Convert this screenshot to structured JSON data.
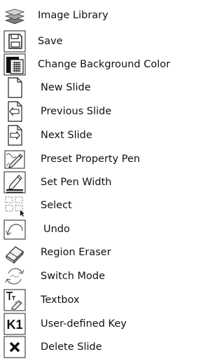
{
  "items": [
    {
      "label": "Image Library",
      "icon": "image-library-icon"
    },
    {
      "label": "Save",
      "icon": "save-icon"
    },
    {
      "label": "Change Background Color",
      "icon": "background-color-icon"
    },
    {
      "label": "New Slide",
      "icon": "new-slide-icon"
    },
    {
      "label": "Previous Slide",
      "icon": "previous-slide-icon"
    },
    {
      "label": "Next Slide",
      "icon": "next-slide-icon"
    },
    {
      "label": "Preset Property Pen",
      "icon": "preset-pen-icon"
    },
    {
      "label": "Set Pen Width",
      "icon": "pen-width-icon"
    },
    {
      "label": "Select",
      "icon": "select-icon"
    },
    {
      "label": "Undo",
      "icon": "undo-icon"
    },
    {
      "label": "Region Eraser",
      "icon": "eraser-icon"
    },
    {
      "label": "Switch Mode",
      "icon": "switch-mode-icon"
    },
    {
      "label": "Textbox",
      "icon": "textbox-icon"
    },
    {
      "label": "User-defined Key",
      "icon": "user-defined-key-icon",
      "icon_text": "K1"
    },
    {
      "label": "Delete Slide",
      "icon": "delete-slide-icon"
    }
  ]
}
